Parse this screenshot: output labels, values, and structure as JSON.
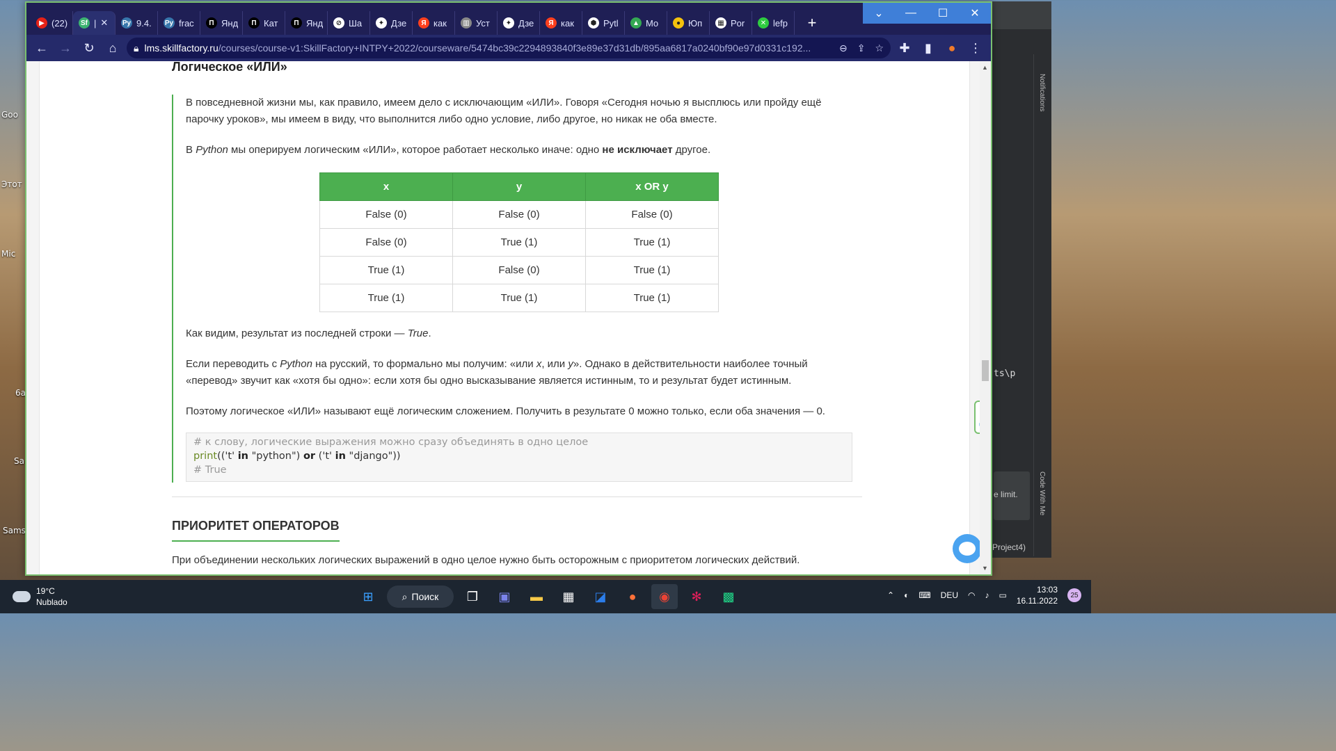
{
  "desktop": {
    "labels": [
      "Goo",
      "Этот",
      "Mic",
      "6a",
      "Sa",
      "Sams"
    ]
  },
  "browser": {
    "tabs": [
      {
        "label": "(22)",
        "color": "#e62117",
        "glyph": "▶"
      },
      {
        "label": "Sf",
        "color": "#3cb371",
        "glyph": "Sf",
        "active": true
      },
      {
        "label": "9.4.",
        "color": "#3776ab",
        "glyph": "Py"
      },
      {
        "label": "frac",
        "color": "#3776ab",
        "glyph": "Py"
      },
      {
        "label": "Янд",
        "color": "#000000",
        "glyph": "П"
      },
      {
        "label": "Кат",
        "color": "#000000",
        "glyph": "П"
      },
      {
        "label": "Янд",
        "color": "#000000",
        "glyph": "П"
      },
      {
        "label": "Ша",
        "color": "#ffffff",
        "glyph": "⊘"
      },
      {
        "label": "Дзе",
        "color": "#ffffff",
        "glyph": "✦"
      },
      {
        "label": "как",
        "color": "#fc3f1d",
        "glyph": "Я"
      },
      {
        "label": "Уст",
        "color": "#888888",
        "glyph": "▥"
      },
      {
        "label": "Дзе",
        "color": "#ffffff",
        "glyph": "✦"
      },
      {
        "label": "как",
        "color": "#fc3f1d",
        "glyph": "Я"
      },
      {
        "label": "Pytl",
        "color": "#ffffff",
        "glyph": "⬢"
      },
      {
        "label": "Mo",
        "color": "#34a853",
        "glyph": "▲"
      },
      {
        "label": "Юп",
        "color": "#f4c20d",
        "glyph": "●"
      },
      {
        "label": "Por",
        "color": "#ffffff",
        "glyph": "▦"
      },
      {
        "label": "lefp",
        "color": "#2ecc40",
        "glyph": "✕"
      }
    ],
    "url_host": "lms.skillfactory.ru",
    "url_path": "/courses/course-v1:SkillFactory+INTPY+2022/courseware/5474bc39c2294893840f3e89e37d31db/895aa6817a0240bf90e97d0331c192..."
  },
  "lesson": {
    "heading_or": "Логическое «ИЛИ»",
    "para1": "В повседневной жизни мы, как правило, имеем дело с исключающим «ИЛИ». Говоря «Сегодня ночью я высплюсь или пройду ещё парочку уроков», мы имеем в виду, что выполнится либо одно условие, либо другое, но никак не оба вместе.",
    "para2_a": "В ",
    "para2_em": "Python",
    "para2_b": " мы оперируем логическим «ИЛИ», которое работает несколько иначе: одно ",
    "para2_strong": "не исключает",
    "para2_c": " другое.",
    "table": {
      "headers": [
        "x",
        "y",
        "x OR y"
      ],
      "rows": [
        [
          "False (0)",
          "False (0)",
          "False (0)"
        ],
        [
          "False (0)",
          "True (1)",
          "True (1)"
        ],
        [
          "True (1)",
          "False (0)",
          "True (1)"
        ],
        [
          "True (1)",
          "True (1)",
          "True (1)"
        ]
      ]
    },
    "para3_a": "Как видим, результат из последней строки — ",
    "para3_em": "True",
    "para3_b": ".",
    "para4_a": "Если переводить с ",
    "para4_em1": "Python",
    "para4_b": " на русский, то формально мы получим: «или ",
    "para4_em2": "x",
    "para4_c": ", или ",
    "para4_em3": "y",
    "para4_d": "». Однако в действительности наиболее точный «перевод» звучит как «хотя бы одно»: если хотя бы одно высказывание является истинным, то и результат будет истинным.",
    "para5": "Поэтому логическое «ИЛИ» называют ещё логическим сложением. Получить в результате 0 можно только, если оба значения — 0.",
    "code": {
      "comment1": "# к слову, логические выражения можно сразу объединять в одно целое",
      "fn": "print",
      "p1": "((",
      "s1": "'t'",
      "kw_in1": "in",
      "s2": "\"python\"",
      "p2": ")",
      "kw_or": "or",
      "p3": "(",
      "s3": "'t'",
      "kw_in2": "in",
      "s4": "\"django\"",
      "p4": "))",
      "comment2": "# True"
    },
    "heading_priority": "ПРИОРИТЕТ ОПЕРАТОРОВ",
    "para6": "При объединении нескольких логических выражений в одно целое нужно быть осторожным с приоритетом логических действий."
  },
  "ide": {
    "notifications": "Notifications",
    "code_with_me": "Code With Me",
    "code_fragment": "ts\\p",
    "popup_text": "e limit.",
    "status": "Project4)"
  },
  "taskbar": {
    "temp": "19°C",
    "weather": "Nublado",
    "search": "Поиск",
    "lang": "DEU",
    "time": "13:03",
    "date": "16.11.2022",
    "notif_count": "25"
  },
  "colors": {
    "accent_green": "#4caf50",
    "chrome_frame": "#1f1f55"
  }
}
